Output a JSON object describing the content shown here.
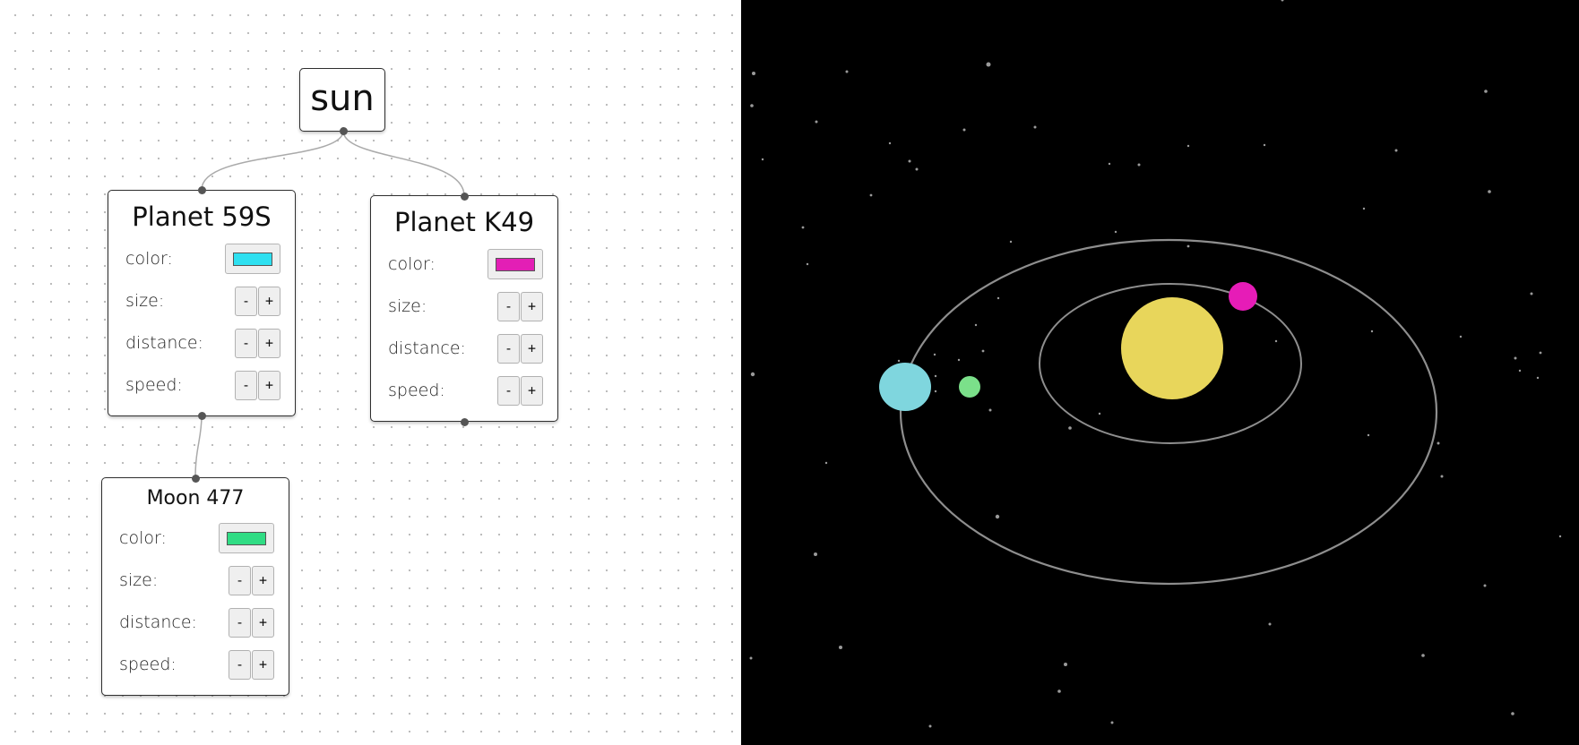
{
  "sun": {
    "title": "sun"
  },
  "planets": [
    {
      "title": "Planet 59S",
      "color_label": "color:",
      "color": "#2ee0f0",
      "size_label": "size:",
      "distance_label": "distance:",
      "speed_label": "speed:"
    },
    {
      "title": "Planet K49",
      "color_label": "color:",
      "color": "#e31fb5",
      "size_label": "size:",
      "distance_label": "distance:",
      "speed_label": "speed:"
    }
  ],
  "moon": {
    "title": "Moon 477",
    "color_label": "color:",
    "color": "#30dc84",
    "size_label": "size:",
    "distance_label": "distance:",
    "speed_label": "speed:"
  },
  "stepper": {
    "minus": "-",
    "plus": "+"
  },
  "scene": {
    "background": "#000000",
    "sun_color": "#e8d65b",
    "planet_59s_color": "#7fd6de",
    "planet_k49_color": "#e61cb7",
    "moon_color": "#7be08a",
    "orbit_color": "#8e8e8e",
    "star_color": "#9a9a9a"
  }
}
